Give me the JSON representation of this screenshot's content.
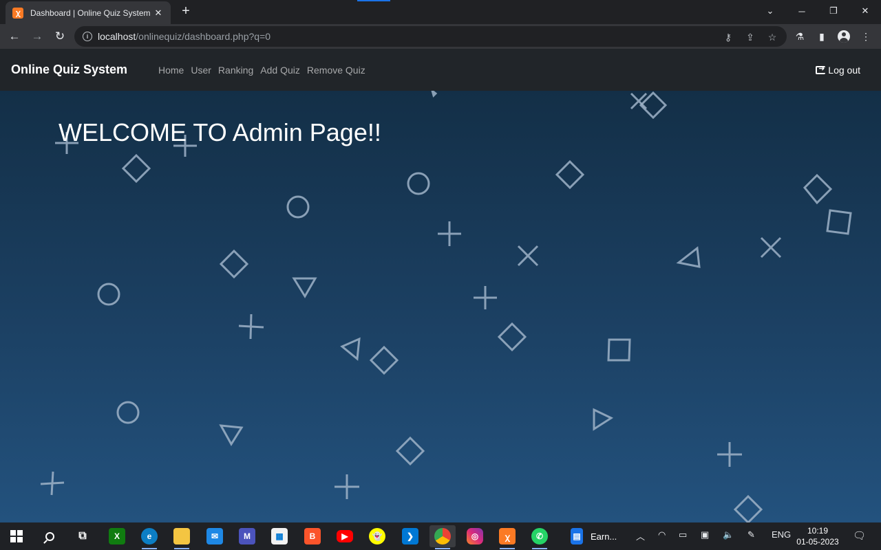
{
  "browser": {
    "tab_title": "Dashboard | Online Quiz System",
    "tab_favicon": "xampp-icon",
    "url_host": "localhost",
    "url_path": "/onlinequiz/dashboard.php?q=0"
  },
  "site": {
    "brand": "Online Quiz System",
    "nav_links": [
      "Home",
      "User",
      "Ranking",
      "Add Quiz",
      "Remove Quiz"
    ],
    "logout": "Log out"
  },
  "main": {
    "welcome": "WELCOME TO Admin Page!!"
  },
  "taskbar": {
    "apps": [
      "windows-start",
      "search",
      "task-view",
      "xbox",
      "edge",
      "file-explorer",
      "mail",
      "teams",
      "microsoft-store",
      "brave",
      "youtube",
      "snapchat",
      "vscode",
      "chrome-dev",
      "instagram",
      "xampp",
      "whatsapp",
      "document"
    ],
    "document_label": "Earn...",
    "language": "ENG",
    "time": "10:19",
    "date": "01-05-2023"
  },
  "colors": {
    "nav_bg": "#212529",
    "main_top": "#132f47",
    "main_bottom": "#23527e",
    "shape_stroke": "#9fb3c8"
  }
}
